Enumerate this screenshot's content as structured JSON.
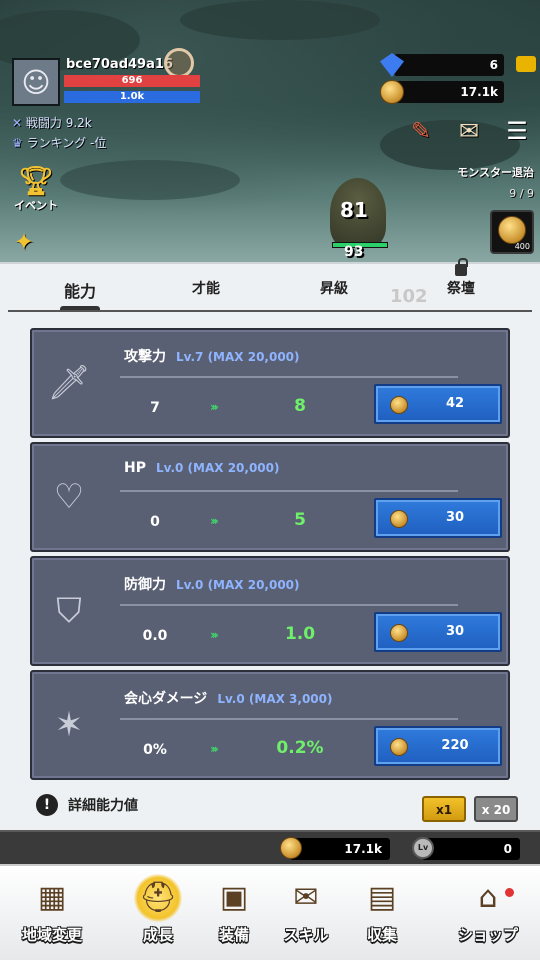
{
  "player": {
    "name": "bce70ad49a16",
    "hp": "696",
    "mp": "1.0k",
    "power": "戦闘力 9.2k",
    "ranking": "ランキング -位"
  },
  "currency": {
    "gems": "6",
    "gold": "17.1k"
  },
  "side": {
    "event_label": "イベント"
  },
  "quest": {
    "title": "モンスター退治",
    "progress": "9 / 9",
    "reward": "400"
  },
  "battle": {
    "damage_main": "81",
    "damage_bg": "102",
    "damage_low": "93"
  },
  "tabs": [
    {
      "label": "能力"
    },
    {
      "label": "才能"
    },
    {
      "label": "昇級"
    },
    {
      "label": "祭壇"
    }
  ],
  "stats": [
    {
      "name": "攻撃力",
      "level": "Lv.7 (MAX 20,000)",
      "current": "7",
      "next": "8",
      "cost": "42",
      "icon": "sword-icon"
    },
    {
      "name": "HP",
      "level": "Lv.0 (MAX 20,000)",
      "current": "0",
      "next": "5",
      "cost": "30",
      "icon": "heart-icon"
    },
    {
      "name": "防御力",
      "level": "Lv.0 (MAX 20,000)",
      "current": "0.0",
      "next": "1.0",
      "cost": "30",
      "icon": "shield-icon"
    },
    {
      "name": "会心ダメージ",
      "level": "Lv.0 (MAX 3,000)",
      "current": "0%",
      "next": "0.2%",
      "cost": "220",
      "icon": "critical-sword-icon"
    }
  ],
  "detail": {
    "label": "詳細能力値",
    "mult_x1": "x1",
    "mult_x20": "x 20"
  },
  "strip": {
    "gold": "17.1k",
    "level_points": "0",
    "lv_badge": "Lv"
  },
  "nav": [
    {
      "label": "地域変更",
      "icon": "map-icon"
    },
    {
      "label": "成長",
      "icon": "helmet-icon"
    },
    {
      "label": "装備",
      "icon": "backpack-icon"
    },
    {
      "label": "スキル",
      "icon": "scroll-icon"
    },
    {
      "label": "収集",
      "icon": "book-icon"
    },
    {
      "label": "ショップ",
      "icon": "chest-icon"
    }
  ]
}
